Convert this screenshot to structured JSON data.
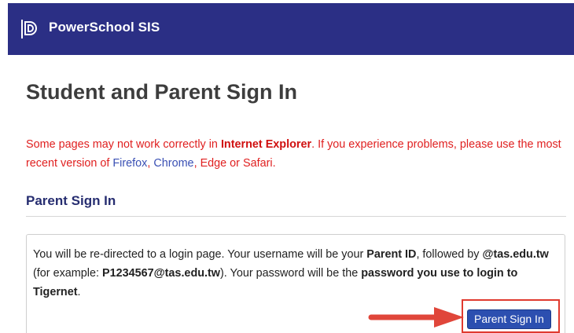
{
  "header": {
    "brand": "PowerSchool SIS",
    "background_color": "#2b2f85",
    "logo_icon": "powerschool-logo-icon"
  },
  "page_title": "Student and Parent Sign In",
  "warning": {
    "part1": "Some pages may not work correctly in ",
    "browser_bold": "Internet Explorer",
    "part2": ". If you experience problems, please use the most recent version of ",
    "firefox": "Firefox",
    "sep1": ", ",
    "chrome": "Chrome",
    "sep2": ", ",
    "edge": "Edge",
    "or": " or ",
    "safari": "Safari",
    "end": ".",
    "color": "#e02020"
  },
  "parent_section": {
    "title": "Parent Sign In",
    "instructions": {
      "t1": "You will be re-directed to a login page. Your username will be your ",
      "b1": "Parent ID",
      "t2": ", followed by ",
      "b2": "@tas.edu.tw",
      "t3": " (for example: ",
      "b3": "P1234567@tas.edu.tw",
      "t4": "). Your password will be the ",
      "b4": "password you use to login to Tigernet",
      "t5": "."
    },
    "button_label": "Parent Sign In",
    "button_color": "#2c4fb0",
    "highlight_color": "#e03a2f",
    "arrow_icon": "right-arrow-icon"
  }
}
